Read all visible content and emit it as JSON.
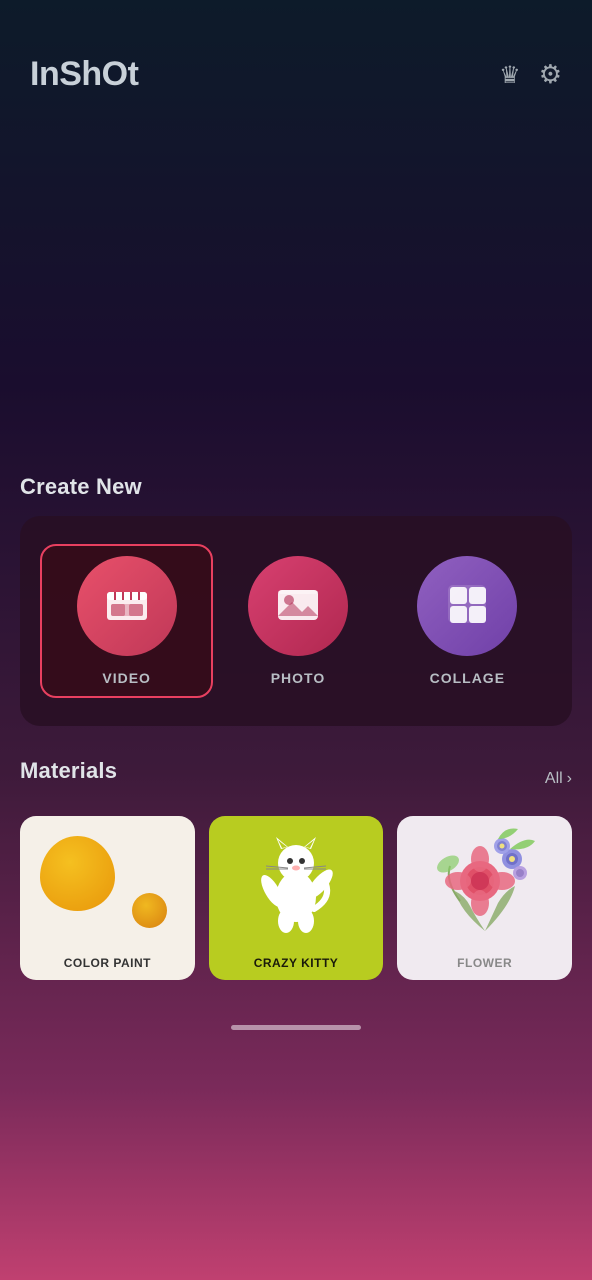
{
  "app": {
    "title": "InShOt"
  },
  "header": {
    "crown_icon": "crown",
    "settings_icon": "gear"
  },
  "create_new": {
    "section_title": "Create New",
    "items": [
      {
        "id": "video",
        "label": "VIDEO",
        "selected": true,
        "icon": "video-clapper"
      },
      {
        "id": "photo",
        "label": "PHOTO",
        "selected": false,
        "icon": "photo-landscape"
      },
      {
        "id": "collage",
        "label": "COLLAGE",
        "selected": false,
        "icon": "grid-layout"
      }
    ]
  },
  "materials": {
    "section_title": "Materials",
    "all_label": "All",
    "chevron": "›",
    "items": [
      {
        "id": "color-paint",
        "label": "COLOR PAINT",
        "theme": "cream"
      },
      {
        "id": "crazy-kitty",
        "label": "CRAZY KITTY",
        "theme": "lime"
      },
      {
        "id": "flower",
        "label": "FLOWER",
        "theme": "pinkwhite"
      }
    ]
  },
  "bottom_indicator": "home"
}
